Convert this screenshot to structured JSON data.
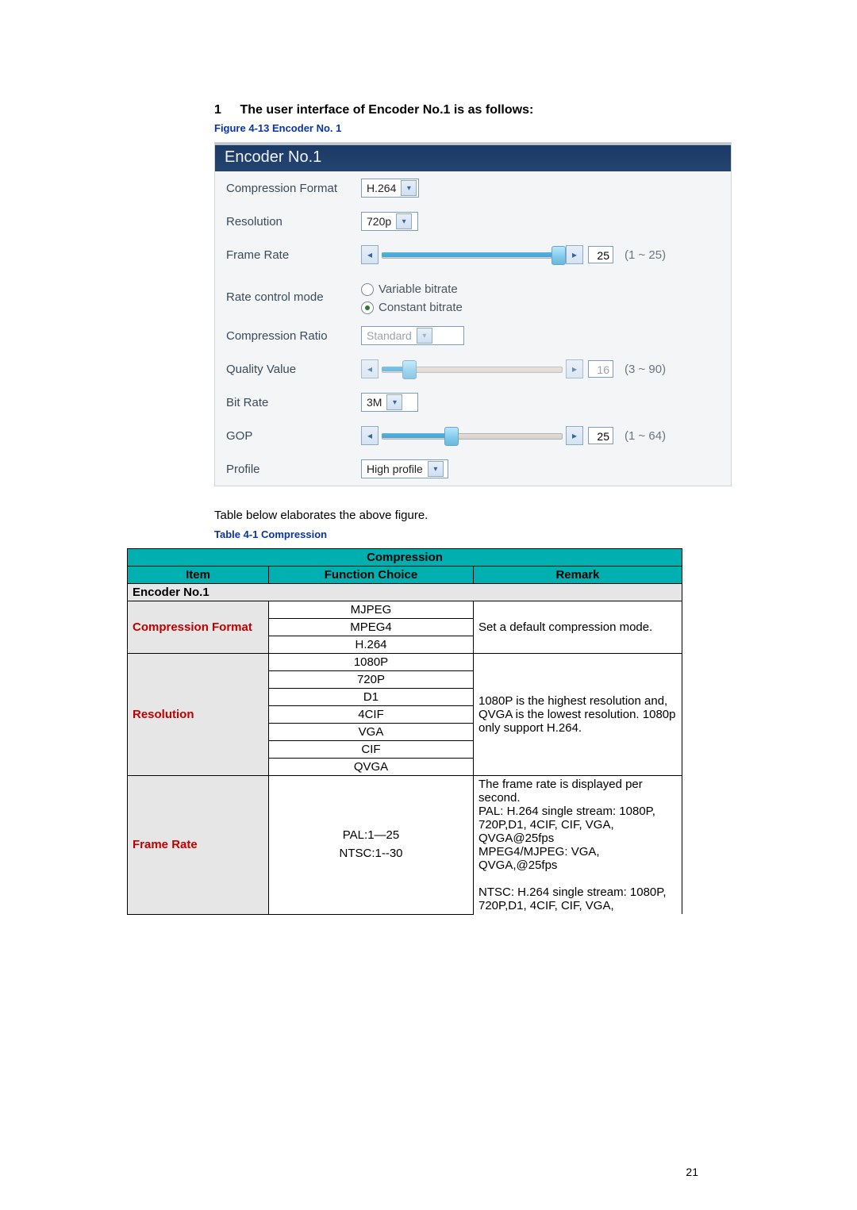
{
  "heading": {
    "num": "1",
    "text": "The user interface of Encoder No.1 is as follows:"
  },
  "figure_caption": "Figure 4-13 Encoder No. 1",
  "encoder": {
    "title": "Encoder No.1",
    "rows": {
      "compression_format": {
        "label": "Compression Format",
        "value": "H.264"
      },
      "resolution": {
        "label": "Resolution",
        "value": "720p"
      },
      "frame_rate": {
        "label": "Frame Rate",
        "value": "25",
        "range": "(1 ~ 25)",
        "min": 1,
        "max": 25
      },
      "rate_control": {
        "label": "Rate control mode",
        "variable_label": "Variable bitrate",
        "constant_label": "Constant bitrate",
        "selected": "constant"
      },
      "compression_ratio": {
        "label": "Compression Ratio",
        "value": "Standard"
      },
      "quality_value": {
        "label": "Quality Value",
        "value": "16",
        "range": "(3 ~ 90)",
        "min": 3,
        "max": 90
      },
      "bit_rate": {
        "label": "Bit Rate",
        "value": "3M"
      },
      "gop": {
        "label": "GOP",
        "value": "25",
        "range": "(1 ~ 64)",
        "min": 1,
        "max": 64
      },
      "profile": {
        "label": "Profile",
        "value": "High profile"
      }
    }
  },
  "table_intro": "Table below elaborates the above figure.",
  "table_caption": "Table 4-1 Compression",
  "table": {
    "title": "Compression",
    "headers": {
      "item": "Item",
      "function_choice": "Function Choice",
      "remark": "Remark"
    },
    "section": "Encoder No.1",
    "rows": {
      "compression_format": {
        "item": "Compression Format",
        "choices": [
          "MJPEG",
          "MPEG4",
          "H.264"
        ],
        "remark": "Set a default compression mode."
      },
      "resolution": {
        "item": "Resolution",
        "choices": [
          "1080P",
          "720P",
          "D1",
          "4CIF",
          "VGA",
          "CIF",
          "QVGA"
        ],
        "remark": "1080P is the highest resolution and, QVGA is the lowest resolution. 1080p only support H.264."
      },
      "frame_rate": {
        "item": "Frame Rate",
        "function_choice": "PAL:1—25\nNTSC:1--30",
        "remark": "The frame rate is displayed per second.\nPAL: H.264 single stream: 1080P, 720P,D1, 4CIF, CIF, VGA, QVGA@25fps\nMPEG4/MJPEG: VGA, QVGA,@25fps\n\nNTSC: H.264 single stream: 1080P, 720P,D1, 4CIF, CIF, VGA,"
      }
    }
  },
  "page_number": "21"
}
